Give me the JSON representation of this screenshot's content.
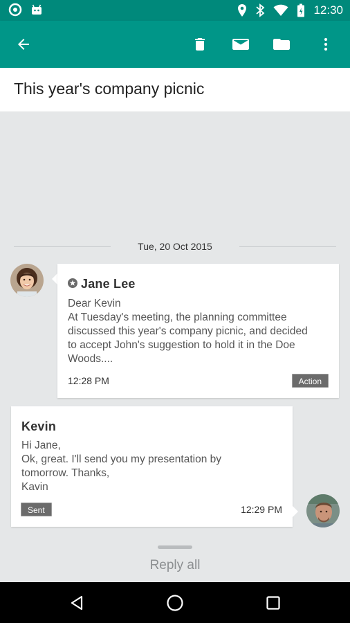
{
  "status_bar": {
    "time": "12:30",
    "icons": [
      "vpn-icon",
      "android-icon",
      "location-icon",
      "bluetooth-icon",
      "wifi-icon",
      "battery-icon"
    ]
  },
  "toolbar": {
    "back_icon": "arrow-back-icon",
    "actions": [
      "delete-icon",
      "mail-icon",
      "folder-icon",
      "more-vert-icon"
    ],
    "color": "#009688"
  },
  "subject": "This year's company picnic",
  "date_separator": "Tue, 20 Oct 2015",
  "messages": [
    {
      "sender": "Jane Lee",
      "starred": true,
      "body_lines": [
        "Dear Kevin",
        "At Tuesday's meeting, the planning committee",
        "discussed this year's company picnic, and decided",
        "to accept John's suggestion to hold it in the Doe",
        "Woods...."
      ],
      "time": "12:28 PM",
      "tag": "Action"
    },
    {
      "sender": "Kevin",
      "body_lines": [
        "Hi Jane,",
        "Ok, great. I'll send you my presentation by",
        "tomorrow. Thanks,",
        "Kavin"
      ],
      "time": "12:29 PM",
      "tag": "Sent"
    }
  ],
  "reply_all": "Reply all",
  "nav_bar": {
    "icons": [
      "back-triangle-icon",
      "home-circle-icon",
      "recents-square-icon"
    ]
  }
}
